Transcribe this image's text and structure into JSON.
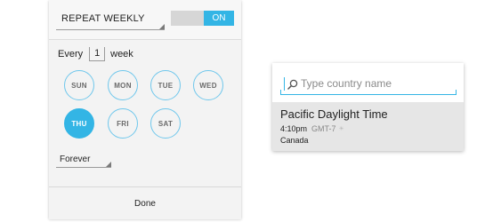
{
  "recurrence": {
    "frequency_value": "REPEAT WEEKLY",
    "toggle_label": "ON",
    "every_prefix": "Every",
    "interval_value": "1",
    "every_unit": "week",
    "days": [
      {
        "label": "SUN",
        "selected": false
      },
      {
        "label": "MON",
        "selected": false
      },
      {
        "label": "TUE",
        "selected": false
      },
      {
        "label": "WED",
        "selected": false
      },
      {
        "label": "THU",
        "selected": true
      },
      {
        "label": "FRI",
        "selected": false
      },
      {
        "label": "SAT",
        "selected": false
      }
    ],
    "end_value": "Forever",
    "done_label": "Done"
  },
  "timezone": {
    "search_placeholder": "Type country name",
    "item": {
      "name": "Pacific Daylight Time",
      "time": "4:10pm",
      "offset": "GMT-7",
      "country": "Canada"
    }
  },
  "colors": {
    "accent": "#33b5e5",
    "panel_bg": "#f3f3f3",
    "item_highlight": "#e6e6e6"
  },
  "icons": [
    "search-icon",
    "spinner-corner-icon",
    "dst-icon"
  ]
}
